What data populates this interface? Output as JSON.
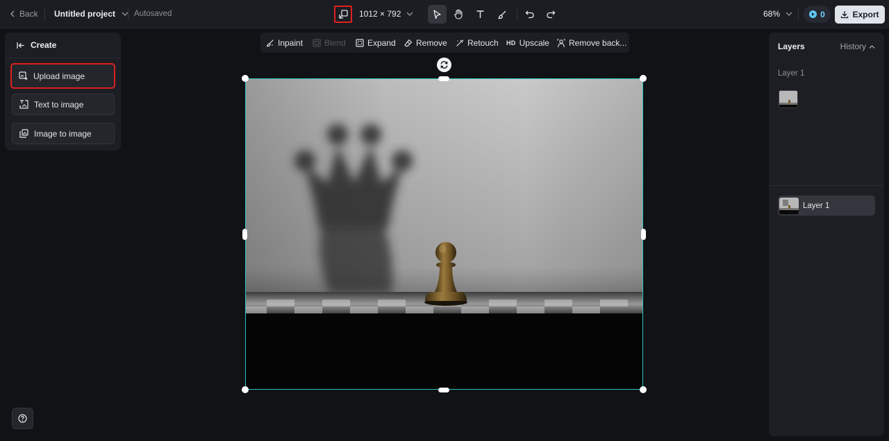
{
  "topbar": {
    "back_label": "Back",
    "project_title": "Untitled project",
    "autosave_status": "Autosaved",
    "canvas_size": "1012 × 792",
    "zoom_level": "68%",
    "credits": "0",
    "export_label": "Export"
  },
  "tools": [
    {
      "name": "select-tool",
      "icon": "pointer-icon",
      "active": true
    },
    {
      "name": "hand-tool",
      "icon": "hand-icon",
      "active": false
    },
    {
      "name": "text-tool",
      "icon": "text-icon",
      "active": false
    },
    {
      "name": "brush-tool",
      "icon": "brush-icon",
      "active": false
    },
    {
      "name": "undo-button",
      "icon": "undo-icon",
      "active": false
    },
    {
      "name": "redo-button",
      "icon": "redo-icon",
      "active": false
    }
  ],
  "create_panel": {
    "title": "Create",
    "items": [
      {
        "label": "Upload image",
        "icon": "upload-image-icon",
        "highlighted": true
      },
      {
        "label": "Text to image",
        "icon": "text-to-image-icon",
        "highlighted": false
      },
      {
        "label": "Image to image",
        "icon": "image-to-image-icon",
        "highlighted": false
      }
    ]
  },
  "edit_toolbar": {
    "items": [
      {
        "label": "Inpaint",
        "icon": "inpaint-icon",
        "enabled": true
      },
      {
        "label": "Blend",
        "icon": "blend-icon",
        "enabled": false
      },
      {
        "label": "Expand",
        "icon": "expand-icon",
        "enabled": true
      },
      {
        "label": "Remove",
        "icon": "eraser-icon",
        "enabled": true
      },
      {
        "label": "Retouch",
        "icon": "retouch-icon",
        "enabled": true
      },
      {
        "label": "Upscale",
        "icon": "hd-icon",
        "badge": "HD",
        "enabled": true
      },
      {
        "label": "Remove back...",
        "icon": "remove-background-icon",
        "enabled": true
      }
    ]
  },
  "layers_panel": {
    "tab_layers": "Layers",
    "tab_history": "History",
    "section_label": "Layer 1",
    "layers": [
      {
        "label": "Layer 1",
        "selected": true
      }
    ]
  },
  "colors": {
    "background": "#111216",
    "panel": "#1c1e23",
    "selection": "#2ec4c0",
    "highlight_red": "#e02020",
    "export_bg": "#dfe3ea",
    "credits_accent": "#5ec8f5"
  }
}
